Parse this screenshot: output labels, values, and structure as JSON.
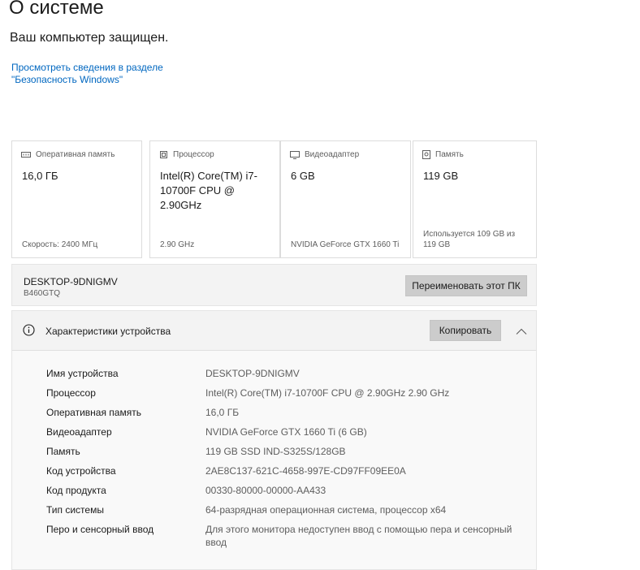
{
  "page": {
    "title": "О системе",
    "protection_status": "Ваш компьютер защищен.",
    "security_link": "Просмотреть сведения в разделе \"Безопасность Windows\""
  },
  "cards": [
    {
      "icon": "memory-chip-icon",
      "label": "Оперативная память",
      "value": "16,0 ГБ",
      "detail": "Скорость: 2400 МГц"
    },
    {
      "icon": "processor-icon",
      "label": "Процессор",
      "value": "Intel(R) Core(TM) i7-10700F CPU @ 2.90GHz",
      "detail": "2.90 GHz"
    },
    {
      "icon": "display-adapter-icon",
      "label": "Видеоадаптер",
      "value": "6 GB",
      "detail": "NVIDIA GeForce GTX 1660 Ti"
    },
    {
      "icon": "storage-drive-icon",
      "label": "Память",
      "value": "119 GB",
      "detail": "Используется 109 GB из 119 GB"
    }
  ],
  "pc": {
    "name": "DESKTOP-9DNIGMV",
    "model": "B460GTQ",
    "rename_button": "Переименовать этот ПК"
  },
  "specs": {
    "header": "Характеристики устройства",
    "copy_button": "Копировать",
    "rows": [
      {
        "key": "Имя устройства",
        "value": "DESKTOP-9DNIGMV"
      },
      {
        "key": "Процессор",
        "value": "Intel(R) Core(TM) i7-10700F CPU @ 2.90GHz   2.90 GHz"
      },
      {
        "key": "Оперативная память",
        "value": "16,0 ГБ"
      },
      {
        "key": "Видеоадаптер",
        "value": "NVIDIA GeForce GTX 1660 Ti (6 GB)"
      },
      {
        "key": "Память",
        "value": "119 GB SSD IND-S325S/128GB"
      },
      {
        "key": "Код устройства",
        "value": "2AE8C137-621C-4658-997E-CD97FF09EE0A"
      },
      {
        "key": "Код продукта",
        "value": "00330-80000-00000-AA433"
      },
      {
        "key": "Тип системы",
        "value": "64-разрядная операционная система, процессор x64"
      },
      {
        "key": "Перо и сенсорный ввод",
        "value": "Для этого монитора недоступен ввод с помощью пера и сенсорный ввод"
      }
    ]
  }
}
